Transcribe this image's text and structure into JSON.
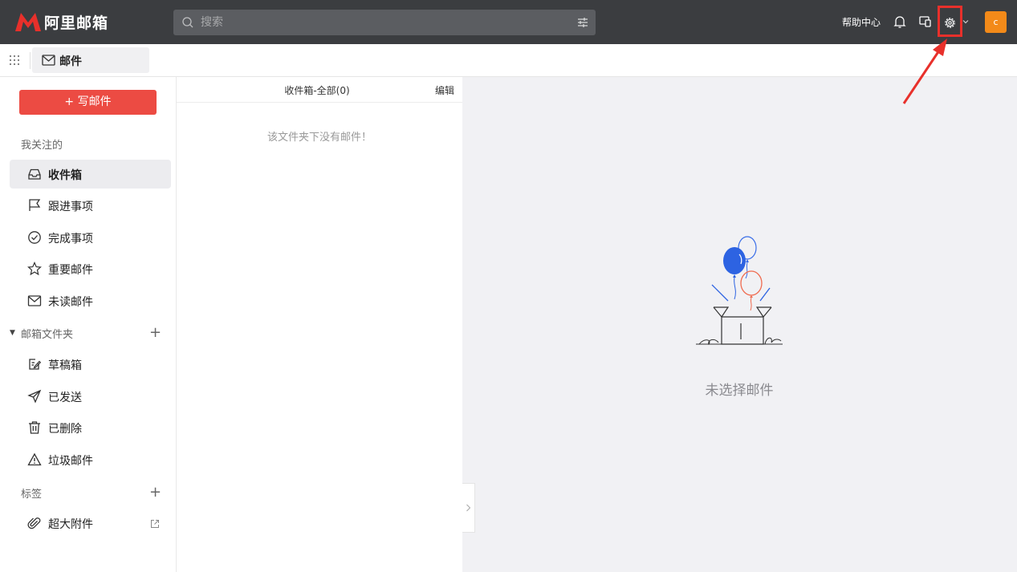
{
  "app": {
    "brand": "阿里邮箱",
    "search_placeholder": "搜索",
    "help_label": "帮助中心",
    "avatar_letter": "c",
    "brand_color": "#e8302b",
    "accent_color": "#f38a19"
  },
  "subbar": {
    "mail_tab_label": "邮件"
  },
  "sidebar": {
    "compose_label": "+ 写邮件",
    "favorites_title": "我关注的",
    "favorites": [
      {
        "label": "收件箱",
        "icon": "inbox-icon"
      },
      {
        "label": "跟进事项",
        "icon": "flag-icon"
      },
      {
        "label": "完成事项",
        "icon": "check-circle-icon"
      },
      {
        "label": "重要邮件",
        "icon": "star-icon"
      },
      {
        "label": "未读邮件",
        "icon": "envelope-icon"
      }
    ],
    "folders_title": "邮箱文件夹",
    "folders": [
      {
        "label": "草稿箱",
        "icon": "draft-icon"
      },
      {
        "label": "已发送",
        "icon": "send-icon"
      },
      {
        "label": "已删除",
        "icon": "trash-icon"
      },
      {
        "label": "垃圾邮件",
        "icon": "warning-icon"
      }
    ],
    "tags_title": "标签",
    "attachment_label": "超大附件"
  },
  "list": {
    "title": "收件箱-全部(0)",
    "edit_label": "编辑",
    "empty_text": "该文件夹下没有邮件！"
  },
  "preview": {
    "empty_text": "未选择邮件"
  }
}
